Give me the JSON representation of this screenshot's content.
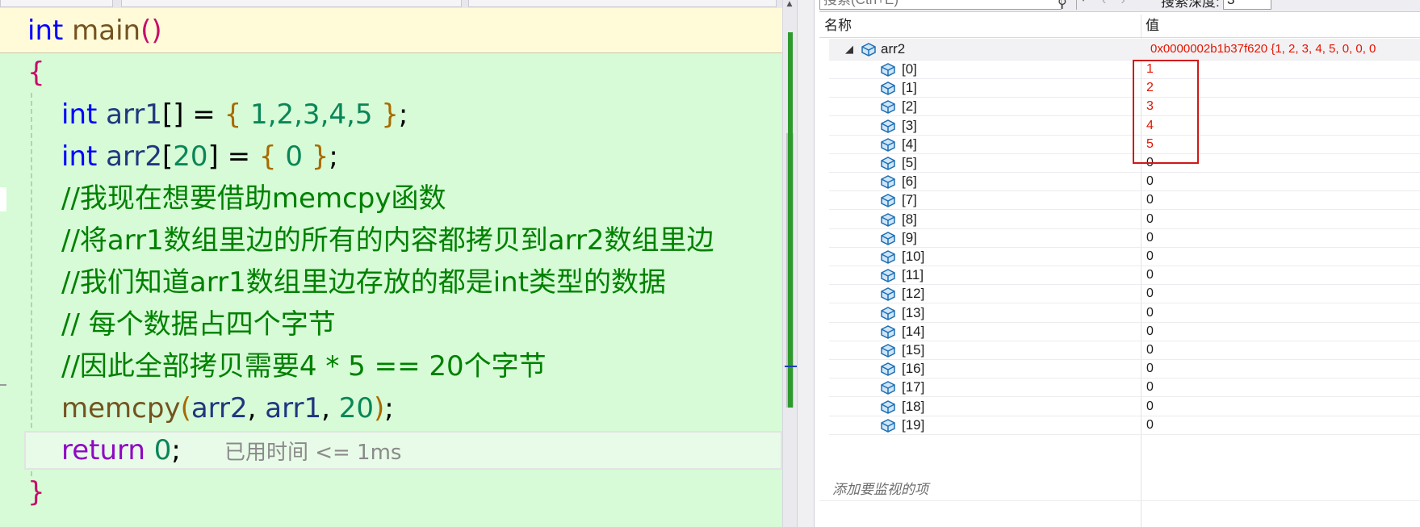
{
  "editor": {
    "code": {
      "l1_kw": "int",
      "l1_fn": "main",
      "l1_paren": "()",
      "l2_brace": "{",
      "l3_kw": "int",
      "l3_var": "arr1",
      "l3_br": "[]",
      "l3_eq": " = ",
      "l3_ob": "{",
      "l3_vals": " 1,2,3,4,5 ",
      "l3_cb": "}",
      "l3_semi": ";",
      "l4_kw": "int",
      "l4_var": "arr2",
      "l4_ob": "[",
      "l4_num": "20",
      "l4_cb": "]",
      "l4_eq": " = ",
      "l4_oc": "{",
      "l4_zero": " 0 ",
      "l4_cc": "}",
      "l4_semi": ";",
      "c1": "//我现在想要借助memcpy函数",
      "c2": "//将arr1数组里边的所有的内容都拷贝到arr2数组里边",
      "c3": "//我们知道arr1数组里边存放的都是int类型的数据",
      "c4": "// 每个数据占四个字节",
      "c5": "//因此全部拷贝需要4 * 5 == 20个字节",
      "l10_fn": "memcpy",
      "l10_op": "(",
      "l10_a": "arr2",
      "l10_c1": ", ",
      "l10_b": "arr1",
      "l10_c2": ", ",
      "l10_n": "20",
      "l10_cp": ")",
      "l10_semi": ";",
      "l11_kw": "return",
      "l11_num": "0",
      "l11_semi": ";",
      "l11_hint": "已用时间 <= 1ms",
      "l12_brace": "}"
    }
  },
  "watch": {
    "search_placeholder": "搜索(Ctrl+E)",
    "depth_label": "搜索深度:",
    "depth_value": "3",
    "columns": {
      "name": "名称",
      "value": "值"
    },
    "root": {
      "name": "arr2",
      "value": "0x0000002b1b37f620 {1, 2, 3, 4, 5, 0, 0, 0"
    },
    "items": [
      {
        "name": "[0]",
        "value": "1"
      },
      {
        "name": "[1]",
        "value": "2"
      },
      {
        "name": "[2]",
        "value": "3"
      },
      {
        "name": "[3]",
        "value": "4"
      },
      {
        "name": "[4]",
        "value": "5"
      },
      {
        "name": "[5]",
        "value": "0"
      },
      {
        "name": "[6]",
        "value": "0"
      },
      {
        "name": "[7]",
        "value": "0"
      },
      {
        "name": "[8]",
        "value": "0"
      },
      {
        "name": "[9]",
        "value": "0"
      },
      {
        "name": "[10]",
        "value": "0"
      },
      {
        "name": "[11]",
        "value": "0"
      },
      {
        "name": "[12]",
        "value": "0"
      },
      {
        "name": "[13]",
        "value": "0"
      },
      {
        "name": "[14]",
        "value": "0"
      },
      {
        "name": "[15]",
        "value": "0"
      },
      {
        "name": "[16]",
        "value": "0"
      },
      {
        "name": "[17]",
        "value": "0"
      },
      {
        "name": "[18]",
        "value": "0"
      },
      {
        "name": "[19]",
        "value": "0"
      }
    ],
    "add_watch": "添加要监视的项",
    "changed_color": "#e51400"
  }
}
